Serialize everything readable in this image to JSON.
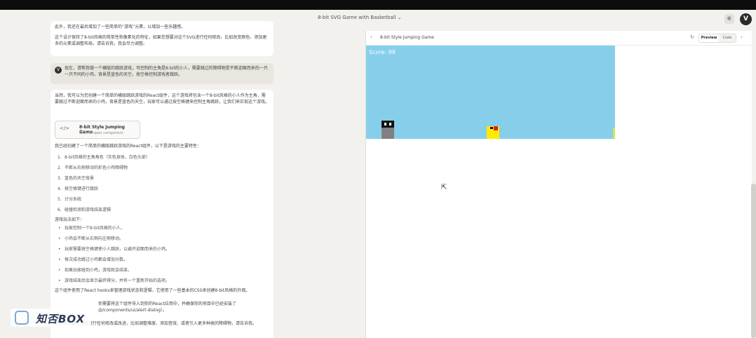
{
  "window": {
    "conversation_title": "8-bit SVG Game with Basketball ⌄",
    "avatar_letter": "V",
    "settings_icon": "sliders-icon"
  },
  "chat": {
    "intro_line1": "此外，我还在最后增加了一些简单的“游戏”元素，以增加一些乐趣感。",
    "intro_line2": "这个设计保持了8-bit风格的简单性和像素化的特征，如果您想要对这个SVG进行任何修改，比如改变颜色、添加更多的元素或调整布局，请告诉我，我会尽力调整。",
    "user_badge": "V",
    "user_text": "现在，请帮我做一个横版的跳跃游戏，可控制的主角是8-bit的小人，需要跳过的障碍物是不断迎面而来的一只一只不同的小鸡，背景是蓝色的天空，按空格控制游戏者跳跃。",
    "reply_intro": "当然，我可以为您创建一个简单的横版跳跃游戏的React组件，这个游戏将包含一个8-bit风格的小人作为主角，需要跳过不断迎面而来的小鸡，背景是蓝色的天空，玩家可以通过按空格键来控制主角跳跃，让我们来实现这个游戏。",
    "component_title": "8-bit Style Jumping Game",
    "component_sub": "Click to open component",
    "after_component": "我已经创建了一个简单的横版跳跃游戏的React组件，以下是游戏的主要特性：",
    "features": [
      "8-bit风格的主角角色（灰色身体，白色头部）",
      "不断从右侧移动的彩色小鸡障碍物",
      "蓝色的天空背景",
      "按空格键进行跳跃",
      "计分系统",
      "碰撞检测和游戏结束逻辑"
    ],
    "howto_title": "游戏玩法如下：",
    "howto": [
      "玩家控制一个8-bit风格的小人。",
      "小鸡会不断从右侧向左侧移动。",
      "玩家需要按空格键使小人跳跃，以避开迎面而来的小鸡。",
      "每次成功跳过小鸡都会增加分数。",
      "如果玩家碰到小鸡，游戏就会结束。",
      "游戏结束后会显示最终得分，并有一个重新开始的选项。"
    ],
    "tail1": "这个组件使用了React hooks来管理游戏状态和逻辑，它使用了一些基本的CSS来创建8-bit风格的外观。",
    "tail2": "你需要将这个组件导入到你的React应用中，并确保你的项目中已经安装了 @/components/ui/alert-dialog）。",
    "tail3": "如果你想要对游戏进行任何修改或改进，比如调整难度、添加音效、或者引入更多种类的障碍物，请告诉我。"
  },
  "watermark": {
    "text": "知否BOX"
  },
  "artifact": {
    "title": "8-bit Style Jumping Game",
    "preview_label": "Preview",
    "code_label": "Code",
    "score_text": "Score: 99",
    "sky_color": "#87ceeb"
  }
}
